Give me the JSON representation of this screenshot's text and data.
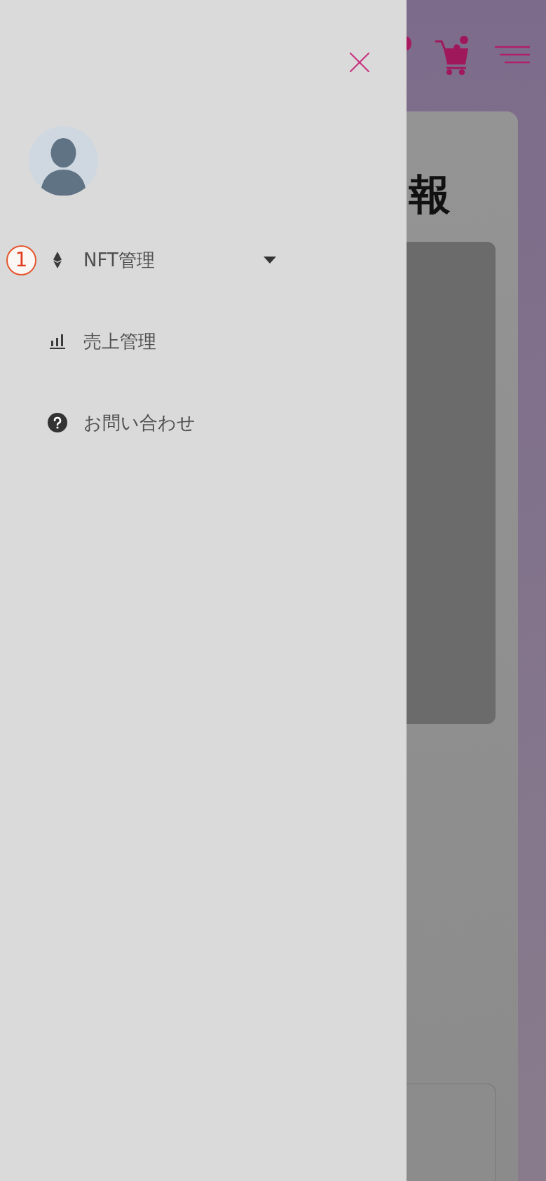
{
  "drawer": {
    "menu": [
      {
        "kind": "group",
        "label": "NFT管理",
        "expanded": false,
        "callout": "1"
      },
      {
        "kind": "link",
        "label": "売上管理"
      },
      {
        "kind": "link",
        "label": "お問い合わせ"
      }
    ]
  },
  "background_page": {
    "heading": "報"
  }
}
